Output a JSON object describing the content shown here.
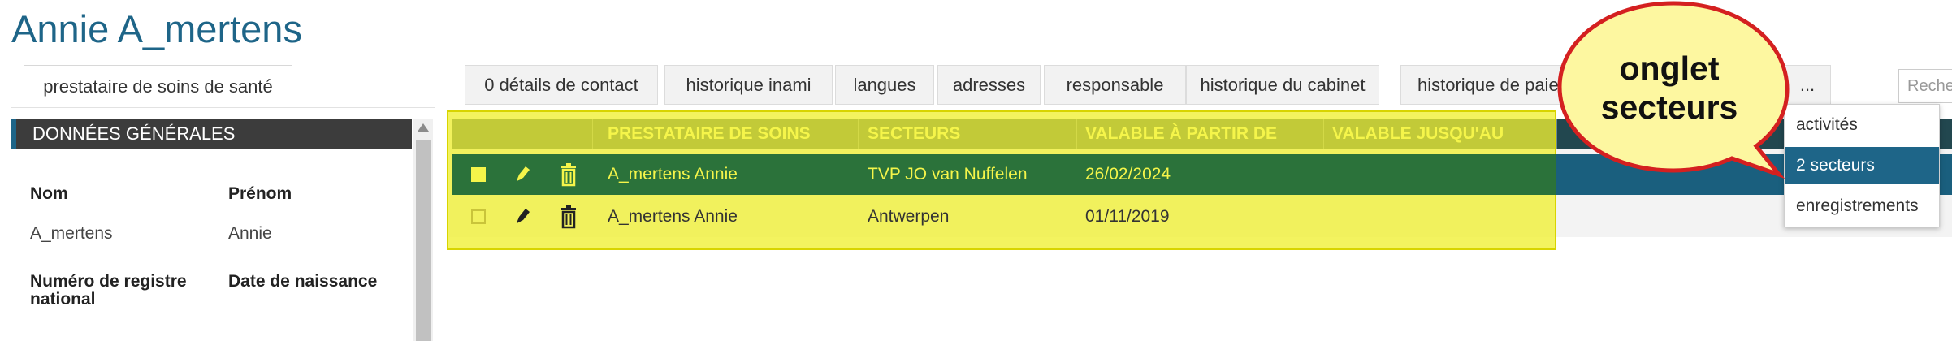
{
  "page": {
    "title": "Annie A_mertens"
  },
  "left_tab": {
    "label": "prestataire de soins de santé"
  },
  "left_panel": {
    "header": "DONNÉES GÉNÉRALES",
    "fields": {
      "nom_label": "Nom",
      "prenom_label": "Prénom",
      "nom_value": "A_mertens",
      "prenom_value": "Annie",
      "registre_label_1": "Numéro de registre",
      "registre_label_2": "national",
      "naissance_label": "Date de naissance"
    }
  },
  "tabs": [
    {
      "label": "0 détails de contact"
    },
    {
      "label": "historique inami"
    },
    {
      "label": "langues"
    },
    {
      "label": "adresses"
    },
    {
      "label": "responsable"
    },
    {
      "label": "historique du cabinet"
    },
    {
      "label": "historique de paiement"
    },
    {
      "label": "..."
    }
  ],
  "search": {
    "placeholder": "Rechercher"
  },
  "table": {
    "headers": [
      "PRESTATAIRE DE SOINS",
      "SECTEURS",
      "VALABLE À PARTIR DE",
      "VALABLE JUSQU'AU"
    ],
    "rows": [
      {
        "prestataire": "A_mertens Annie",
        "secteur": "TVP JO van Nuffelen",
        "valable_debut": "26/02/2024",
        "valable_fin": ""
      },
      {
        "prestataire": "A_mertens Annie",
        "secteur": "Antwerpen",
        "valable_debut": "01/11/2019",
        "valable_fin": ""
      }
    ]
  },
  "dropdown": {
    "items": [
      {
        "label": "activités"
      },
      {
        "label": "2 secteurs"
      },
      {
        "label": "enregistrements"
      }
    ],
    "selected": "2 secteurs"
  },
  "callout": {
    "line1": "onglet",
    "line2": "secteurs"
  },
  "colors": {
    "title": "#1e6588",
    "header_bg": "#22474f",
    "selected_row": "#1a5f7e",
    "highlight": "#f0f032",
    "callout_fill": "#fdf7a0",
    "callout_border": "#d42020"
  },
  "icons": [
    "pencil-icon",
    "trash-icon",
    "checkbox"
  ]
}
